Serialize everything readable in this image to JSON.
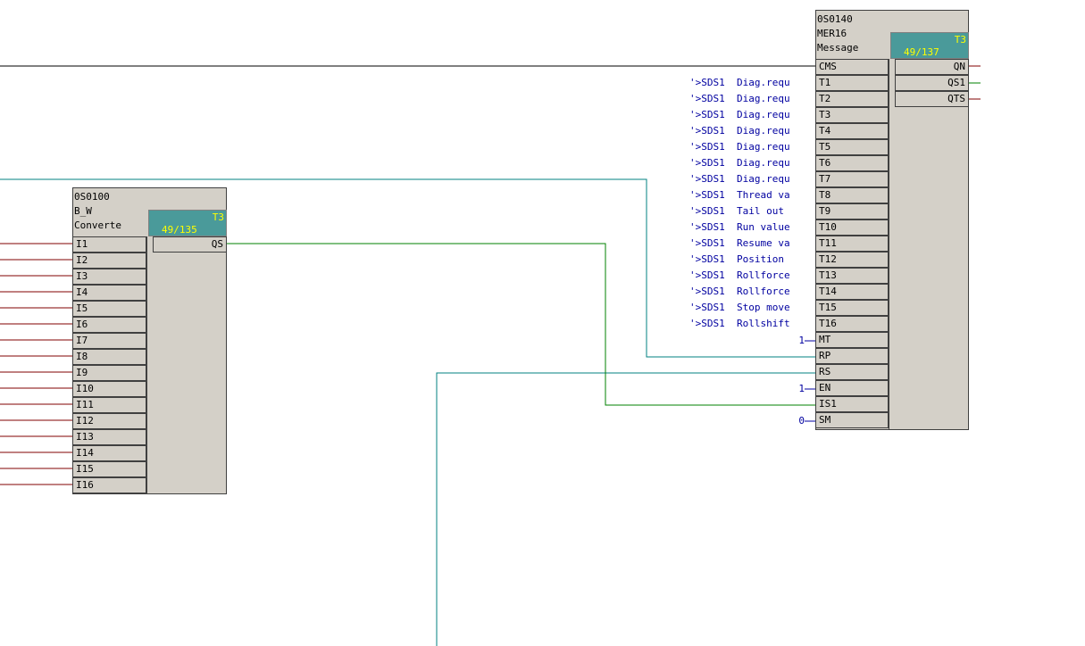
{
  "block_left": {
    "id": "0S0100",
    "type": "B_W",
    "comment": "Converte",
    "task": "T3",
    "order": "49/135",
    "inputs": [
      "I1",
      "I2",
      "I3",
      "I4",
      "I5",
      "I6",
      "I7",
      "I8",
      "I9",
      "I10",
      "I11",
      "I12",
      "I13",
      "I14",
      "I15",
      "I16"
    ],
    "outputs": [
      "QS"
    ]
  },
  "block_right": {
    "id": "0S0140",
    "type": "MER16",
    "comment": "Message",
    "task": "T3",
    "order": "49/137",
    "inputs": [
      "CMS",
      "T1",
      "T2",
      "T3",
      "T4",
      "T5",
      "T6",
      "T7",
      "T8",
      "T9",
      "T10",
      "T11",
      "T12",
      "T13",
      "T14",
      "T15",
      "T16",
      "MT",
      "RP",
      "RS",
      "EN",
      "IS1",
      "SM"
    ],
    "outputs": [
      "QN",
      "QS1",
      "QTS"
    ]
  },
  "input_labels": [
    "'>SDS1  Diag.requ",
    "'>SDS1  Diag.requ",
    "'>SDS1  Diag.requ",
    "'>SDS1  Diag.requ",
    "'>SDS1  Diag.requ",
    "'>SDS1  Diag.requ",
    "'>SDS1  Diag.requ",
    "'>SDS1  Thread va",
    "'>SDS1  Tail out",
    "'>SDS1  Run value",
    "'>SDS1  Resume va",
    "'>SDS1  Position",
    "'>SDS1  Rollforce",
    "'>SDS1  Rollforce",
    "'>SDS1  Stop move",
    "'>SDS1  Rollshift"
  ],
  "constants": {
    "MT": "1",
    "EN": "1",
    "SM": "0"
  },
  "colors": {
    "wire_red": "#800000",
    "wire_green": "#008000",
    "wire_teal": "#008080",
    "wire_black": "#000000",
    "block_face": "#d4d0c8",
    "task_box": "#4a9a9a",
    "task_text": "#ffff00",
    "label_text": "#0000a0"
  }
}
